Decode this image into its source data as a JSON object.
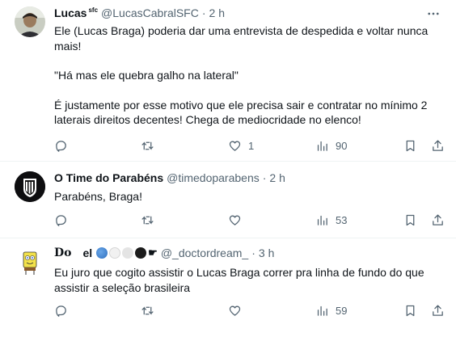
{
  "tweets": [
    {
      "name": "Lucas",
      "name_badge": "sfc",
      "handle": "@LucasCabralSFC",
      "time": "2 h",
      "avatar_icon": "user-photo",
      "lines": [
        "Ele (Lucas Braga) poderia dar uma entrevista de despedida e voltar nunca",
        "mais!",
        "",
        "\"Há mas ele quebra galho na lateral\"",
        "",
        "É justamente por esse motivo que ele precisa sair e contratar no mínimo 2",
        "laterais direitos decentes! Chega de mediocridade no elenco!"
      ],
      "reply_count": "",
      "retweet_count": "",
      "like_count": "1",
      "views_count": "90"
    },
    {
      "name": "O Time do Parabéns",
      "handle": "@timedoparabens",
      "time": "2 h",
      "avatar_icon": "team-crest",
      "lines": [
        "Parabéns, Braga!"
      ],
      "reply_count": "",
      "retweet_count": "",
      "like_count": "",
      "views_count": "53"
    },
    {
      "name_prefix": "Do",
      "name_suffix": "el",
      "handle": "@_doctordream_",
      "time": "3 h",
      "avatar_icon": "cartoon-sponge",
      "lines": [
        "Eu juro que cogito assistir o Lucas Braga correr pra linha de fundo do que",
        "assistir a seleção brasileira"
      ],
      "reply_count": "",
      "retweet_count": "",
      "like_count": "",
      "views_count": "59"
    }
  ],
  "colors": {
    "text": "#0f1419",
    "muted": "#536471",
    "divider": "#eff3f4"
  }
}
